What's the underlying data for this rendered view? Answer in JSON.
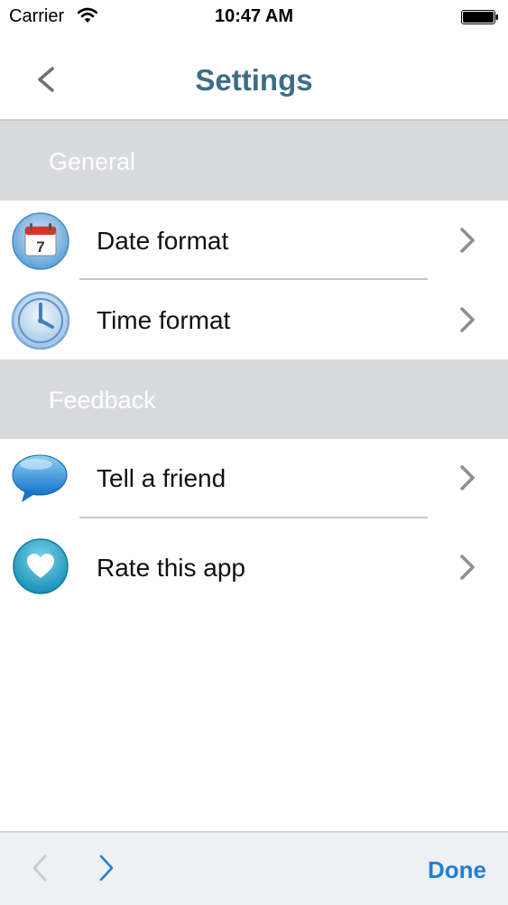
{
  "status_bar": {
    "carrier": "Carrier",
    "time": "10:47 AM",
    "wifi_icon": "wifi-icon",
    "battery_icon": "battery-icon"
  },
  "nav": {
    "title": "Settings",
    "back_icon": "chevron-left-icon"
  },
  "sections": [
    {
      "title": "General",
      "rows": [
        {
          "label": "Date format",
          "icon": "calendar-icon",
          "calendar_day": "7"
        },
        {
          "label": "Time format",
          "icon": "clock-icon"
        }
      ]
    },
    {
      "title": "Feedback",
      "rows": [
        {
          "label": "Tell a friend",
          "icon": "speech-bubble-icon"
        },
        {
          "label": "Rate this app",
          "icon": "heart-icon"
        }
      ]
    }
  ],
  "toolbar": {
    "back_icon": "chevron-left-icon",
    "forward_icon": "chevron-right-icon",
    "done_label": "Done"
  },
  "colors": {
    "title": "#3b6e86",
    "section_header_bg": "#d8dadd",
    "toolbar_accent": "#1f7fd8"
  }
}
